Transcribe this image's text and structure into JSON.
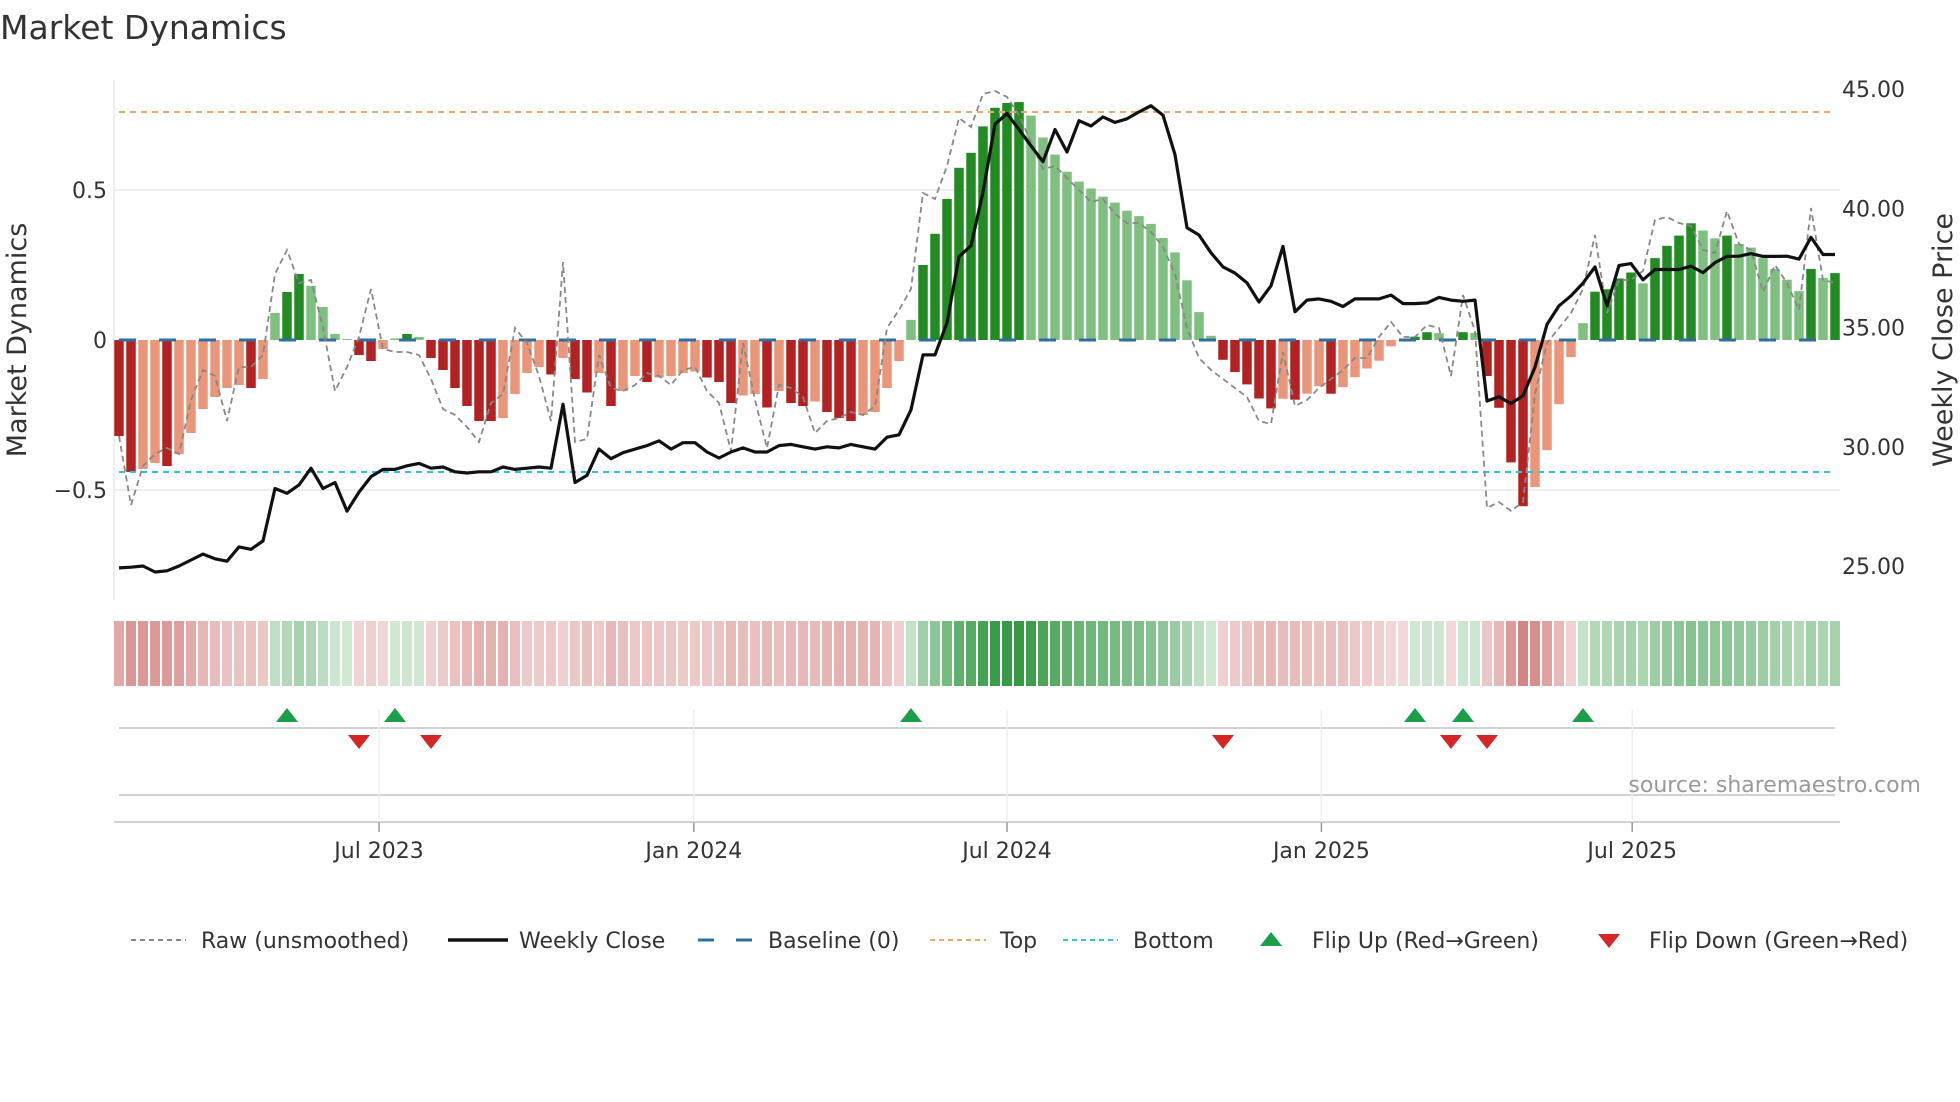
{
  "title": "Market Dynamics",
  "source": "source: sharemaestro.com",
  "colors": {
    "strong_red": "#b22222",
    "weak_red": "#e9967a",
    "strong_green": "#228b22",
    "weak_green": "#7fbf7f",
    "raw": "#888888",
    "close": "#111111",
    "baseline": "#2f6f9f",
    "top": "#f0a868",
    "bottom": "#2ec4dc",
    "flip_up": "#1a9e4a",
    "flip_down": "#d62728"
  },
  "legend": {
    "raw": "Raw (unsmoothed)",
    "close": "Weekly Close",
    "baseline": "Baseline (0)",
    "top": "Top",
    "bottom": "Bottom",
    "flip_up": "Flip Up (Red→Green)",
    "flip_down": "Flip Down (Green→Red)"
  },
  "chart_data": {
    "type": "bar",
    "title": "Market Dynamics",
    "ylabel": "Market Dynamics",
    "y2label": "Weekly Close Price",
    "x_unit": "week index (weekly, 144 weeks)",
    "ylim": [
      -0.9,
      0.86
    ],
    "y2lim": [
      23.0,
      45.5
    ],
    "yticks": [
      {
        "v": 0.5,
        "label": "0.5"
      },
      {
        "v": 0,
        "label": "0"
      },
      {
        "v": -0.5,
        "label": "−0.5"
      }
    ],
    "y2ticks": [
      {
        "v": 45,
        "label": "45.00"
      },
      {
        "v": 40,
        "label": "40.00"
      },
      {
        "v": 35,
        "label": "35.00"
      },
      {
        "v": 30,
        "label": "30.00"
      },
      {
        "v": 25,
        "label": "25.00"
      }
    ],
    "xticks": [
      {
        "week": 22.67,
        "label": "Jul 2023"
      },
      {
        "week": 48.9,
        "label": "Jan 2024"
      },
      {
        "week": 75.0,
        "label": "Jul 2024"
      },
      {
        "week": 101.2,
        "label": "Jan 2025"
      },
      {
        "week": 127.1,
        "label": "Jul 2025"
      }
    ],
    "top_level": 0.76,
    "bottom_level": -0.44,
    "baseline": 0,
    "grid": true,
    "legend_position": "bottom",
    "series": [
      {
        "name": "Market Dynamics (smoothed)",
        "type": "bar",
        "values": [
          -0.32,
          -0.44,
          -0.43,
          -0.41,
          -0.42,
          -0.38,
          -0.31,
          -0.23,
          -0.19,
          -0.16,
          -0.15,
          -0.16,
          -0.13,
          0.09,
          0.16,
          0.22,
          0.18,
          0.11,
          0.02,
          0.003,
          -0.05,
          -0.07,
          -0.03,
          0.005,
          0.02,
          0.01,
          -0.06,
          -0.1,
          -0.16,
          -0.22,
          -0.27,
          -0.27,
          -0.26,
          -0.18,
          -0.11,
          -0.09,
          -0.115,
          -0.06,
          -0.13,
          -0.175,
          -0.11,
          -0.22,
          -0.17,
          -0.12,
          -0.14,
          -0.125,
          -0.12,
          -0.11,
          -0.105,
          -0.125,
          -0.14,
          -0.21,
          -0.185,
          -0.18,
          -0.225,
          -0.17,
          -0.21,
          -0.22,
          -0.205,
          -0.24,
          -0.26,
          -0.27,
          -0.25,
          -0.24,
          -0.16,
          -0.07,
          0.067,
          0.25,
          0.354,
          0.47,
          0.574,
          0.624,
          0.712,
          0.774,
          0.79,
          0.793,
          0.748,
          0.675,
          0.618,
          0.561,
          0.528,
          0.505,
          0.478,
          0.458,
          0.431,
          0.413,
          0.387,
          0.34,
          0.292,
          0.199,
          0.093,
          0.014,
          -0.066,
          -0.107,
          -0.148,
          -0.195,
          -0.228,
          -0.196,
          -0.199,
          -0.179,
          -0.154,
          -0.179,
          -0.157,
          -0.124,
          -0.095,
          -0.069,
          -0.021,
          -0.003,
          0.011,
          0.026,
          0.023,
          -0.003,
          0.026,
          0.024,
          -0.12,
          -0.226,
          -0.408,
          -0.554,
          -0.49,
          -0.367,
          -0.214,
          -0.057,
          0.056,
          0.161,
          0.169,
          0.205,
          0.225,
          0.189,
          0.273,
          0.314,
          0.348,
          0.389,
          0.365,
          0.339,
          0.348,
          0.32,
          0.308,
          0.273,
          0.237,
          0.201,
          0.163,
          0.237,
          0.207,
          0.223
        ]
      },
      {
        "name": "Raw (unsmoothed)",
        "type": "line",
        "values": [
          -0.32,
          -0.55,
          -0.42,
          -0.38,
          -0.36,
          -0.38,
          -0.2,
          -0.1,
          -0.12,
          -0.27,
          -0.09,
          -0.09,
          -0.05,
          0.22,
          0.3,
          0.19,
          0.2,
          0.04,
          -0.17,
          -0.09,
          0.01,
          0.17,
          -0.03,
          -0.04,
          -0.04,
          -0.05,
          -0.13,
          -0.23,
          -0.25,
          -0.29,
          -0.34,
          -0.21,
          -0.18,
          0.04,
          -0.01,
          -0.12,
          -0.27,
          0.26,
          -0.34,
          -0.33,
          -0.05,
          -0.16,
          -0.17,
          -0.15,
          -0.11,
          -0.12,
          -0.15,
          -0.1,
          -0.09,
          -0.17,
          -0.21,
          -0.37,
          -0.01,
          -0.2,
          -0.36,
          -0.15,
          -0.16,
          -0.19,
          -0.31,
          -0.27,
          -0.26,
          -0.24,
          -0.25,
          -0.22,
          0.04,
          0.1,
          0.17,
          0.49,
          0.47,
          0.58,
          0.74,
          0.71,
          0.82,
          0.83,
          0.81,
          0.75,
          0.66,
          0.57,
          0.58,
          0.54,
          0.5,
          0.46,
          0.47,
          0.42,
          0.39,
          0.39,
          0.36,
          0.31,
          0.22,
          0.04,
          -0.06,
          -0.1,
          -0.13,
          -0.16,
          -0.19,
          -0.27,
          -0.28,
          -0.04,
          -0.22,
          -0.2,
          -0.16,
          -0.13,
          -0.1,
          -0.06,
          -0.06,
          0.01,
          0.06,
          0.01,
          0.01,
          0.05,
          0.04,
          -0.12,
          0.15,
          0.03,
          -0.56,
          -0.54,
          -0.57,
          -0.54,
          -0.18,
          -0.01,
          0.04,
          0.09,
          0.17,
          0.35,
          0.09,
          0.2,
          0.2,
          0.23,
          0.4,
          0.41,
          0.39,
          0.38,
          0.3,
          0.29,
          0.43,
          0.32,
          0.3,
          0.16,
          0.25,
          0.19,
          0.1,
          0.44,
          0.2,
          0.19
        ]
      },
      {
        "name": "Weekly Close",
        "type": "line",
        "axis": "right",
        "values": [
          24.92,
          24.95,
          25.0,
          24.75,
          24.8,
          25.0,
          25.25,
          25.5,
          25.3,
          25.2,
          25.8,
          25.7,
          26.05,
          28.25,
          28.05,
          28.4,
          29.1,
          28.25,
          28.5,
          27.3,
          28.1,
          28.75,
          29.05,
          29.05,
          29.2,
          29.3,
          29.1,
          29.15,
          28.95,
          28.9,
          28.95,
          28.95,
          29.15,
          29.05,
          29.1,
          29.15,
          29.1,
          31.78,
          28.5,
          28.8,
          29.9,
          29.5,
          29.75,
          29.9,
          30.05,
          30.25,
          29.9,
          30.17,
          30.17,
          29.78,
          29.53,
          29.78,
          29.95,
          29.78,
          29.78,
          30.05,
          30.1,
          30.0,
          29.9,
          30.0,
          29.95,
          30.1,
          30.0,
          29.9,
          30.4,
          30.5,
          31.55,
          33.85,
          33.85,
          35.2,
          37.97,
          38.43,
          40.68,
          43.52,
          43.97,
          43.3,
          42.62,
          41.95,
          43.3,
          42.36,
          43.67,
          43.45,
          43.83,
          43.6,
          43.75,
          44.04,
          44.3,
          43.9,
          42.25,
          39.18,
          38.88,
          38.13,
          37.54,
          37.28,
          36.87,
          36.07,
          36.75,
          38.4,
          35.66,
          36.15,
          36.2,
          36.1,
          35.88,
          36.2,
          36.2,
          36.2,
          36.36,
          36.0,
          36.0,
          36.03,
          36.26,
          36.15,
          36.1,
          36.15,
          31.92,
          32.1,
          31.81,
          32.14,
          33.34,
          35.13,
          35.91,
          36.33,
          36.86,
          37.54,
          35.91,
          37.6,
          37.68,
          37.0,
          37.43,
          37.43,
          37.43,
          37.57,
          37.3,
          37.72,
          37.98,
          37.99,
          38.1,
          37.98,
          37.98,
          37.99,
          37.87,
          38.78,
          38.06,
          38.06
        ]
      }
    ],
    "flips_up_weeks": [
      15,
      24,
      67,
      109,
      113,
      123
    ],
    "flips_down_weeks": [
      21,
      27,
      93,
      112,
      115
    ]
  }
}
